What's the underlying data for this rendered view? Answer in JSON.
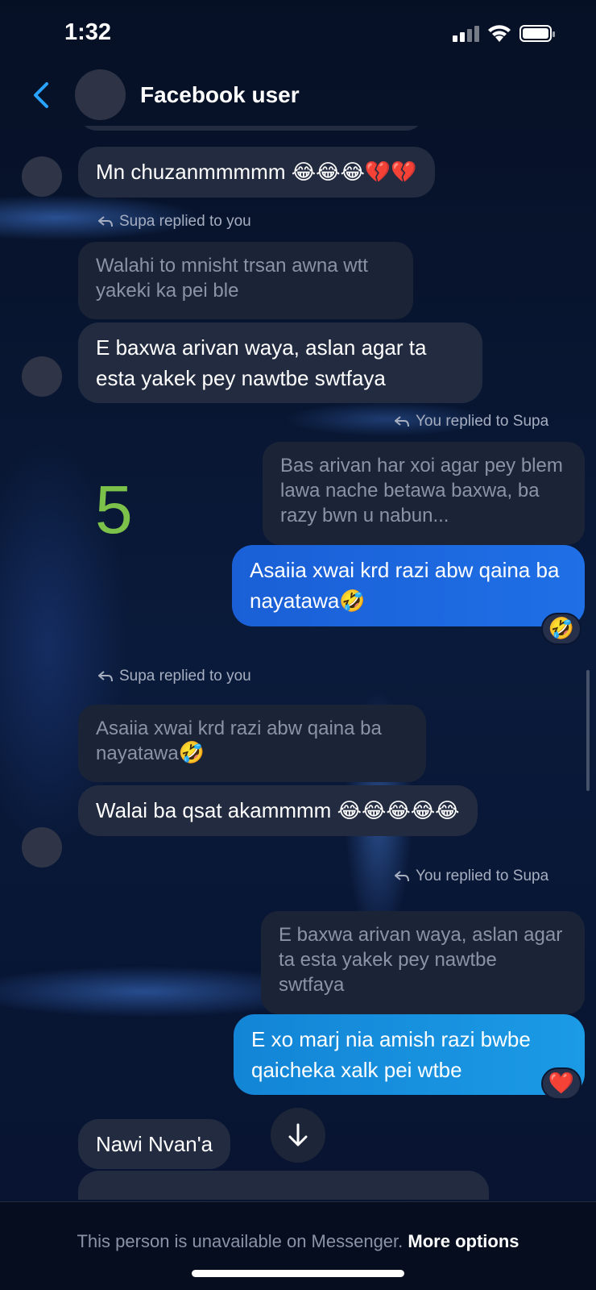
{
  "status_bar": {
    "time": "1:32"
  },
  "header": {
    "name": "Facebook user"
  },
  "messages": {
    "m1_text": "Mn chuzanmmmmm",
    "m1_emoji": "😂😂😂💔💔",
    "r1_label": "Supa replied to you",
    "r1_quote": "Walahi to mnisht trsan awna wtt yakeki ka pei ble",
    "r1_text": "E baxwa arivan waya, aslan agar ta esta yakek pey nawtbe swtfaya",
    "r2_label": "You replied to Supa",
    "r2_quote": "Bas arivan har xoi agar pey blem lawa nache betawa baxwa, ba razy bwn u nabun...",
    "r2_text": "Asaiia xwai krd razi abw qaina ba nayatawa",
    "r2_emoji": "🤣",
    "r2_reaction": "🤣",
    "r3_label": "Supa replied to you",
    "r3_quote": "Asaiia xwai krd razi abw qaina ba nayatawa",
    "r3_quote_emoji": "🤣",
    "r3_text": "Walai ba qsat akammmm",
    "r3_emoji": "😂😂😂😂😂",
    "r4_label": "You replied to Supa",
    "r4_quote": "E baxwa arivan waya, aslan agar ta esta yakek pey nawtbe swtfaya",
    "r4_text": "E xo marj nia amish razi bwbe qaicheka xalk pei wtbe",
    "r4_reaction": "❤️",
    "last_text": "Nawi Nvan'a"
  },
  "overlay_number": "5",
  "footer": {
    "text": "This person is unavailable on Messenger.",
    "link": "More options"
  }
}
